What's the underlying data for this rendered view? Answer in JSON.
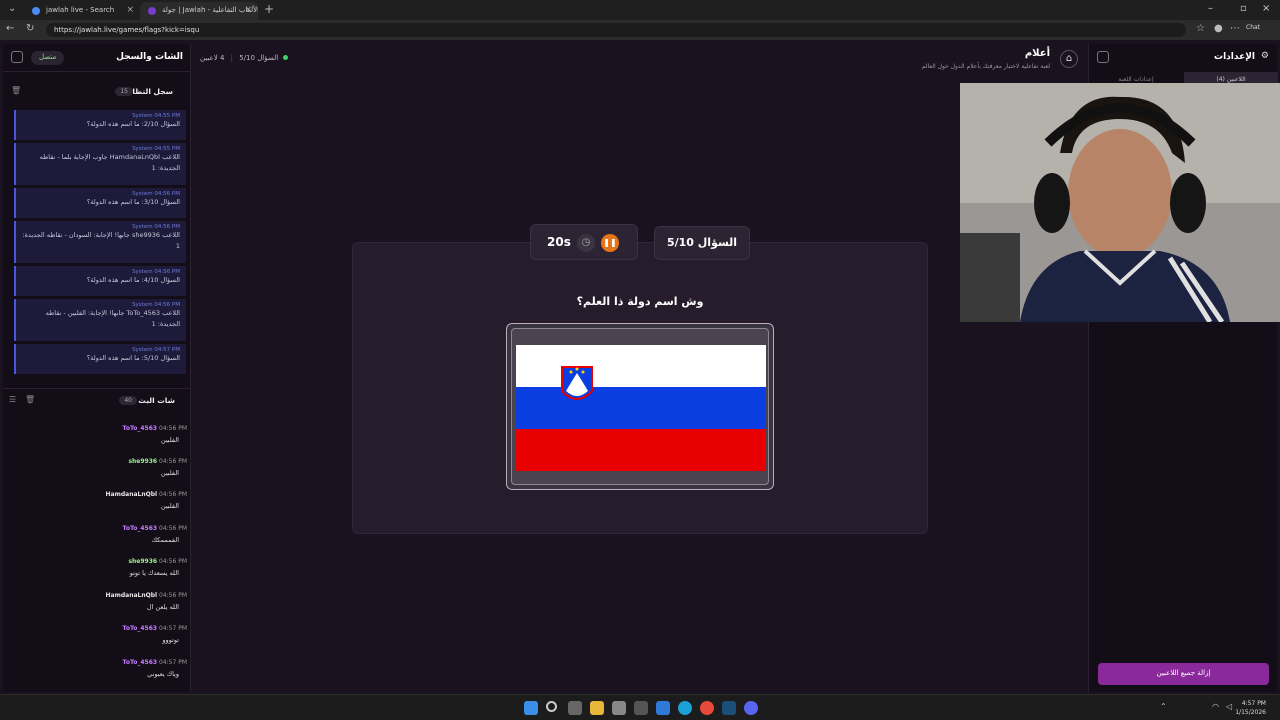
{
  "browser": {
    "tabs": [
      {
        "label": "jawlah live - Search"
      },
      {
        "label": "جولة | Jawlah - منصة الألعاب التفاعلية"
      }
    ],
    "url": "https://jawlah.live/games/flags?kick=isqu",
    "chat_button": "Chat"
  },
  "left_panel": {
    "title": "الشات والسجل",
    "status": "متصل",
    "system_log": {
      "title": "سجل النظام",
      "count": "15",
      "entries": [
        {
          "sender": "System",
          "time": "04:55 PM",
          "text": "السؤال 2/10: ما اسم هذه الدولة؟"
        },
        {
          "sender": "System",
          "time": "04:55 PM",
          "text": "اللاعب HamdanaLnQbl جاوب الإجابة بلما - نقاطه الجديدة: 1"
        },
        {
          "sender": "System",
          "time": "04:56 PM",
          "text": "السؤال 3/10: ما اسم هذه الدولة؟"
        },
        {
          "sender": "System",
          "time": "04:56 PM",
          "text": "اللاعب she9936 جابها! الإجابة: السودان - نقاطه الجديدة: 1"
        },
        {
          "sender": "System",
          "time": "04:56 PM",
          "text": "السؤال 4/10: ما اسم هذه الدولة؟"
        },
        {
          "sender": "System",
          "time": "04:56 PM",
          "text": "اللاعب ToTo_4563 جابها! الإجابة: الفلبين - نقاطه الجديدة: 1"
        },
        {
          "sender": "System",
          "time": "04:57 PM",
          "text": "السؤال 5/10: ما اسم هذه الدولة؟"
        }
      ]
    },
    "live_chat": {
      "title": "شات البث",
      "count": "40",
      "messages": [
        {
          "user": "ToTo_4563",
          "time": "04:56 PM",
          "text": "الفلبين",
          "color": "#c77dff"
        },
        {
          "user": "she9936",
          "time": "04:56 PM",
          "text": "الفلبين",
          "color": "#9ef28f"
        },
        {
          "user": "HamdanaLnQbl",
          "time": "04:56 PM",
          "text": "الفلبين",
          "color": "#e6e6e6"
        },
        {
          "user": "ToTo_4563",
          "time": "04:56 PM",
          "text": "الفمممكك",
          "color": "#c77dff"
        },
        {
          "user": "she9936",
          "time": "04:56 PM",
          "text": "الله يسعدك يا توتو",
          "color": "#9ef28f"
        },
        {
          "user": "HamdanaLnQbl",
          "time": "04:56 PM",
          "text": "الله يلعن ال",
          "color": "#e6e6e6"
        },
        {
          "user": "ToTo_4563",
          "time": "04:57 PM",
          "text": "توتووو",
          "color": "#c77dff"
        },
        {
          "user": "ToTo_4563",
          "time": "04:57 PM",
          "text": "وياك يعيوني",
          "color": "#c77dff"
        }
      ]
    }
  },
  "header": {
    "players": "4 لاعبين",
    "question_small": "السؤال 5/10",
    "game_title": "أعلام",
    "game_subtitle": "لعبة تفاعلية لاختبار معرفتك بأعلام الدول حول العالم"
  },
  "game": {
    "question_counter": "السؤال 5/10",
    "timer": "20s",
    "question": "وش اسم دولة ذا العلم؟"
  },
  "right_panel": {
    "title": "الإعدادات",
    "tab_players": "اللاعبين (4)",
    "tab_game": "إعدادات اللعبة",
    "kick_all": "إزالة جميع اللاعبين"
  },
  "taskbar": {
    "time": "4:57 PM",
    "date": "1/15/2026"
  },
  "colors": {
    "accent": "#e8741a",
    "kick": "#8a2a9a",
    "system_border": "#4b56e0"
  }
}
